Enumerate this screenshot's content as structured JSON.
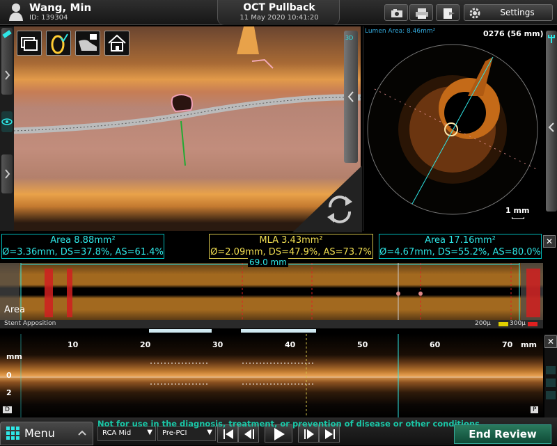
{
  "patient": {
    "name": "Wang, Min",
    "id": "ID: 139304"
  },
  "header": {
    "title": "OCT Pullback",
    "datetime": "11 May 2020 10:41:20",
    "settings_label": "Settings"
  },
  "toolbar_icons": [
    "camera-icon",
    "printer-icon",
    "export-icon",
    "gear-icon"
  ],
  "view3d": {
    "tools": [
      "window-icon",
      "stent-view-icon",
      "cut-view-icon",
      "home-icon"
    ],
    "badge": "3D"
  },
  "cross_section": {
    "lumen_area": "Lumen Area: 8.46mm²",
    "frame": "0276 (56 mm)",
    "scale": "1 mm"
  },
  "measurements": [
    {
      "area": "Area 8.88mm²",
      "detail": "Ø=3.36mm, DS=37.8%, AS=61.4%"
    },
    {
      "area": "MLA 3.43mm²",
      "detail": "Ø=2.09mm, DS=47.9%, AS=73.7%"
    },
    {
      "area": "Area 17.16mm²",
      "detail": "Ø=4.67mm, DS=55.2%, AS=80.0%"
    }
  ],
  "area_graph": {
    "length": "69.0 mm",
    "label": "Area"
  },
  "stent": {
    "label": "Stent Apposition",
    "legend": [
      "200μ",
      "300μ"
    ],
    "legend_colors": [
      "#ffffff",
      "#e0d000",
      "#e02020"
    ]
  },
  "long_view": {
    "ticks": [
      "10",
      "20",
      "30",
      "40",
      "50",
      "60",
      "70"
    ],
    "unit": "mm",
    "y_unit": "mm",
    "y_ticks": [
      "0",
      "2"
    ],
    "marker_left": "D",
    "marker_right": "P"
  },
  "bottom": {
    "menu_label": "Menu",
    "segment": "RCA Mid",
    "phase": "Pre-PCI",
    "disclaimer": "Not for use in the diagnosis, treatment, or prevention of disease or other conditions.",
    "end_review": "End Review"
  },
  "colors": {
    "accent": "#2ee6e6",
    "mla": "#f2df52",
    "stent_gap": "#e02020"
  }
}
